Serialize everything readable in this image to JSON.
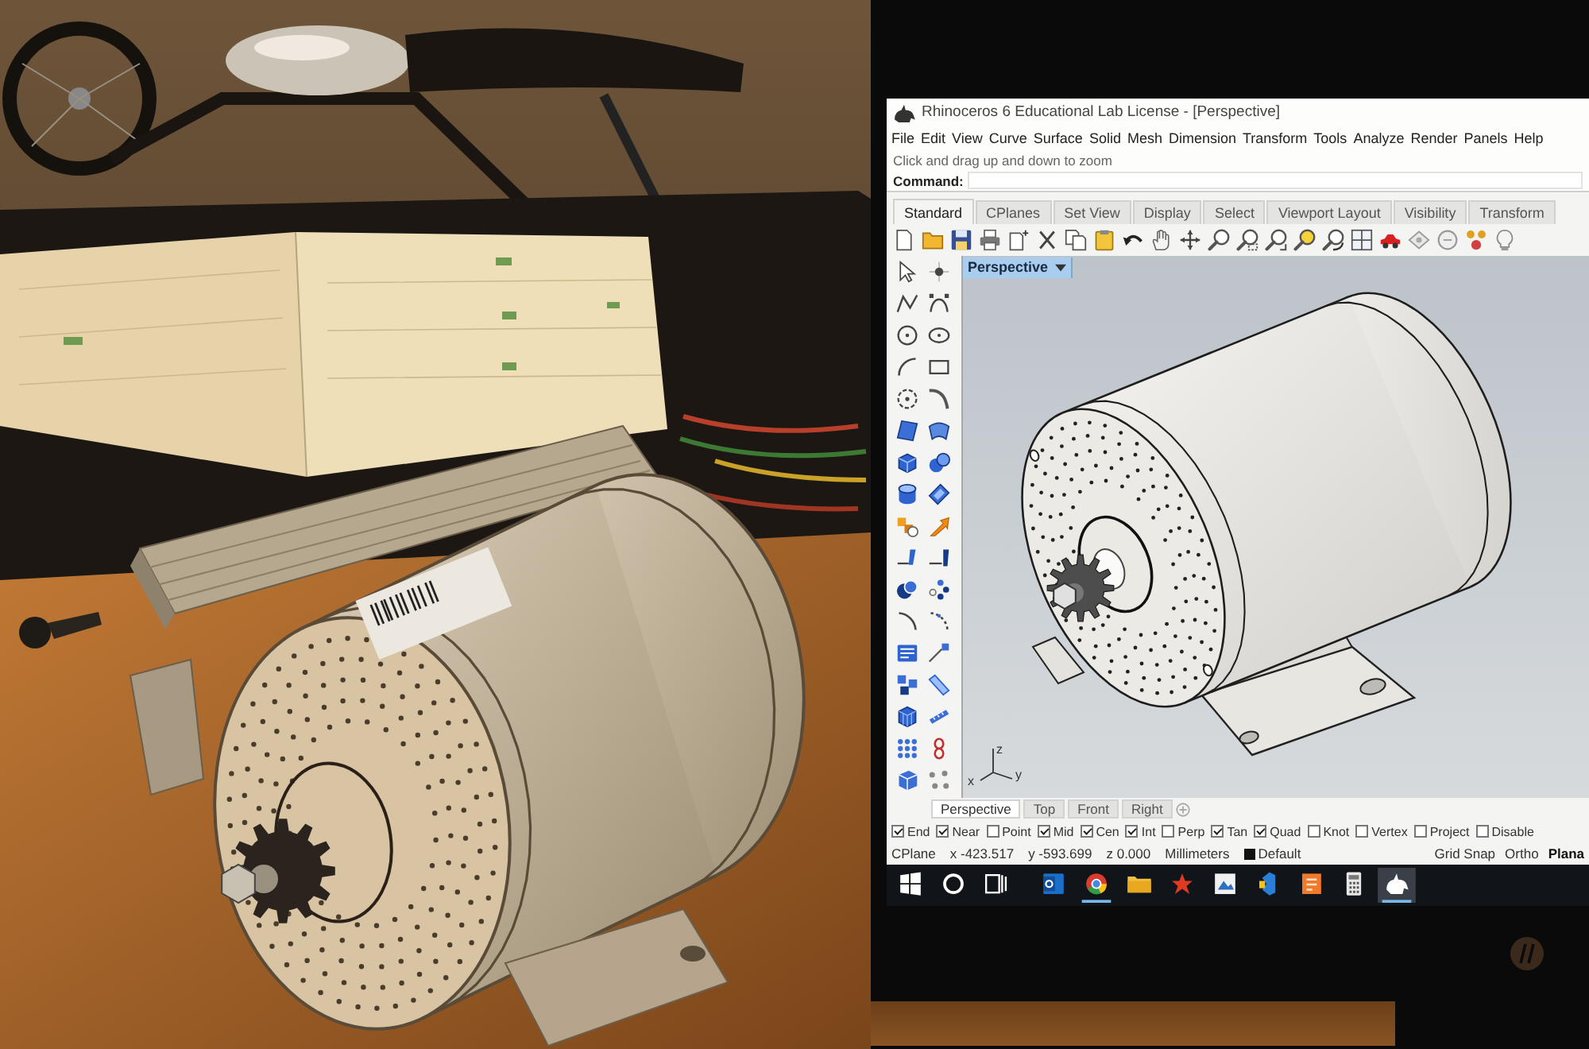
{
  "window": {
    "title": "Rhinoceros 6 Educational Lab License - [Perspective]"
  },
  "menu": [
    "File",
    "Edit",
    "View",
    "Curve",
    "Surface",
    "Solid",
    "Mesh",
    "Dimension",
    "Transform",
    "Tools",
    "Analyze",
    "Render",
    "Panels",
    "Help"
  ],
  "command_area": {
    "history": "Click and drag up and down to zoom",
    "prompt": "Command:"
  },
  "toolbar_tabs": [
    {
      "label": "Standard",
      "selected": true
    },
    {
      "label": "CPlanes",
      "selected": false
    },
    {
      "label": "Set View",
      "selected": false
    },
    {
      "label": "Display",
      "selected": false
    },
    {
      "label": "Select",
      "selected": false
    },
    {
      "label": "Viewport Layout",
      "selected": false
    },
    {
      "label": "Visibility",
      "selected": false
    },
    {
      "label": "Transform",
      "selected": false
    }
  ],
  "viewport": {
    "title": "Perspective",
    "axis_labels": [
      "z",
      "x",
      "y"
    ]
  },
  "viewport_tabs": [
    {
      "label": "Perspective",
      "selected": true
    },
    {
      "label": "Top",
      "selected": false
    },
    {
      "label": "Front",
      "selected": false
    },
    {
      "label": "Right",
      "selected": false
    }
  ],
  "osnaps": [
    {
      "label": "End",
      "checked": true
    },
    {
      "label": "Near",
      "checked": true
    },
    {
      "label": "Point",
      "checked": false
    },
    {
      "label": "Mid",
      "checked": true
    },
    {
      "label": "Cen",
      "checked": true
    },
    {
      "label": "Int",
      "checked": true
    },
    {
      "label": "Perp",
      "checked": false
    },
    {
      "label": "Tan",
      "checked": true
    },
    {
      "label": "Quad",
      "checked": true
    },
    {
      "label": "Knot",
      "checked": false
    },
    {
      "label": "Vertex",
      "checked": false
    },
    {
      "label": "Project",
      "checked": false
    },
    {
      "label": "Disable",
      "checked": false
    }
  ],
  "status_bar": {
    "cplane": "CPlane",
    "coordinates": [
      "x -423.517",
      "y -593.699",
      "z 0.000"
    ],
    "units": "Millimeters",
    "layer": "Default",
    "toggles": [
      {
        "label": "Grid Snap",
        "on": false
      },
      {
        "label": "Ortho",
        "on": false
      },
      {
        "label": "Plana",
        "on": true
      }
    ]
  },
  "taskbar": {
    "buttons": [
      {
        "kind": "start"
      },
      {
        "kind": "search"
      },
      {
        "kind": "taskview"
      }
    ],
    "apps": [
      {
        "kind": "mail",
        "running": false,
        "selected": false
      },
      {
        "kind": "browser",
        "running": true,
        "selected": false
      },
      {
        "kind": "folder",
        "running": false,
        "selected": false
      },
      {
        "kind": "star",
        "running": false,
        "selected": false
      },
      {
        "kind": "picture",
        "running": false,
        "selected": false
      },
      {
        "kind": "ribbon",
        "running": false,
        "selected": false
      },
      {
        "kind": "tile",
        "running": false,
        "selected": false
      },
      {
        "kind": "calculator",
        "running": false,
        "selected": false
      },
      {
        "kind": "rhino",
        "running": true,
        "selected": true
      }
    ]
  }
}
